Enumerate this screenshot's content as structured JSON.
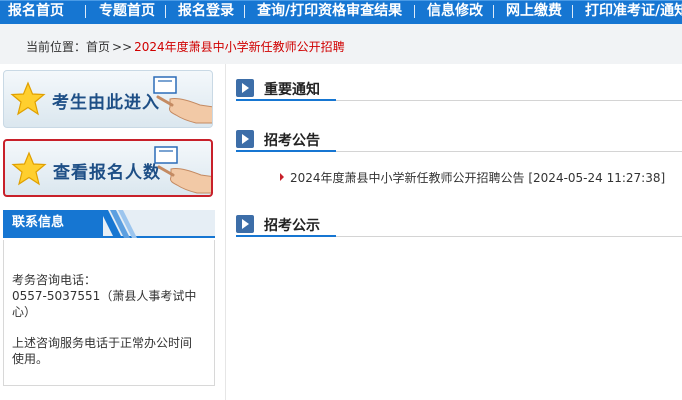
{
  "nav": {
    "items": [
      {
        "label": "报名首页"
      },
      {
        "label": "专题首页"
      },
      {
        "label": "报名登录"
      },
      {
        "label": "查询/打印资格审查结果"
      },
      {
        "label": "信息修改"
      },
      {
        "label": "网上缴费"
      },
      {
        "label": "打印准考证/通知"
      }
    ]
  },
  "breadcrumb": {
    "prefix": "当前位置：",
    "home": "首页",
    "arrows": ">>",
    "current": "2024年度萧县中小学新任教师公开招聘"
  },
  "sidebar": {
    "enter_button": "考生由此进入",
    "count_button": "查看报名人数",
    "contact": {
      "title": "联系信息",
      "line1": "考务咨询电话：",
      "line2": "0557-5037551（萧县人事考试中",
      "line3": "心）",
      "line4": "上述咨询服务电话于正常办公时间",
      "line5": "使用。"
    }
  },
  "main": {
    "sections": [
      {
        "title": "重要通知"
      },
      {
        "title": "招考公告"
      },
      {
        "title": "招考公示"
      }
    ],
    "notices": [
      {
        "text": "2024年度萧县中小学新任教师公开招聘公告 [2024-05-24 11:27:38]"
      }
    ]
  },
  "colors": {
    "nav_bg": "#1676d2",
    "highlight_border": "#c8202a",
    "breadcrumb_current": "#d00000"
  }
}
